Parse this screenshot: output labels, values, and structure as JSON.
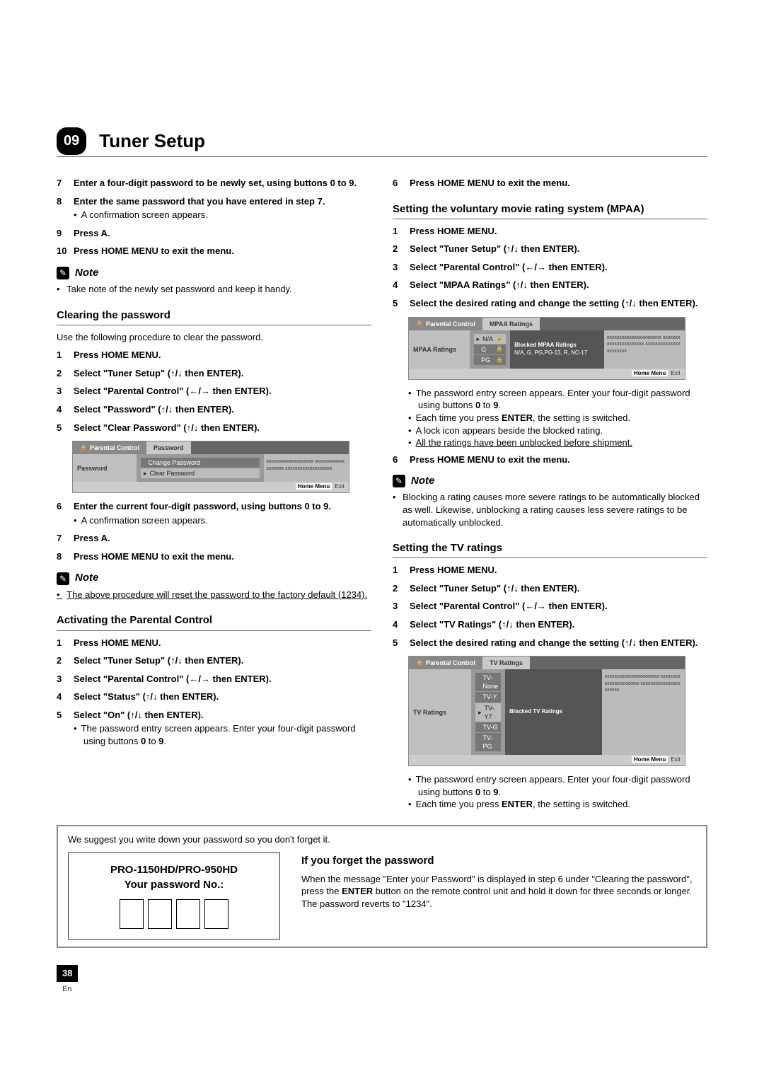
{
  "chapter": {
    "number": "09",
    "title": "Tuner Setup"
  },
  "left": {
    "initialSteps": [
      {
        "n": "7",
        "text": "Enter a four-digit password to be newly set, using buttons 0 to 9."
      },
      {
        "n": "8",
        "text": "Enter the same password that you have entered in step 7.",
        "bullets": [
          "A confirmation screen appears."
        ]
      },
      {
        "n": "9",
        "text": "Press A."
      },
      {
        "n": "10",
        "text": "Press HOME MENU to exit the menu."
      }
    ],
    "note1": "Take note of the newly set password and keep it handy.",
    "clearing": {
      "title": "Clearing the password",
      "intro": "Use the following procedure to clear the password.",
      "steps": [
        {
          "n": "1",
          "text": "Press HOME MENU."
        },
        {
          "n": "2",
          "text": "Select \"Tuner Setup\" (↑/↓ then ENTER)."
        },
        {
          "n": "3",
          "text": "Select \"Parental Control\" (←/→ then ENTER)."
        },
        {
          "n": "4",
          "text": "Select \"Password\" (↑/↓ then ENTER)."
        },
        {
          "n": "5",
          "text": "Select \"Clear Password\" (↑/↓ then ENTER)."
        }
      ],
      "afterFigSteps": [
        {
          "n": "6",
          "text": "Enter the current four-digit password, using buttons 0 to 9.",
          "bullets": [
            "A confirmation screen appears."
          ]
        },
        {
          "n": "7",
          "text": "Press A."
        },
        {
          "n": "8",
          "text": "Press HOME MENU to exit the menu."
        }
      ],
      "note": "The above procedure will reset the password to the factory default (1234)."
    },
    "activating": {
      "title": "Activating the Parental Control",
      "steps": [
        {
          "n": "1",
          "text": "Press HOME MENU."
        },
        {
          "n": "2",
          "text": "Select \"Tuner Setup\" (↑/↓ then ENTER)."
        },
        {
          "n": "3",
          "text": "Select \"Parental Control\" (←/→ then ENTER)."
        },
        {
          "n": "4",
          "text": "Select \"Status\" (↑/↓ then ENTER)."
        },
        {
          "n": "5",
          "text": "Select \"On\" (↑/↓ then ENTER).",
          "bullets": [
            "The password entry screen appears. Enter your four-digit password using buttons 0 to 9."
          ]
        }
      ]
    },
    "osd1": {
      "crumb1": "Parental Control",
      "crumb2": "Password",
      "left": "Password",
      "opts": [
        "Change Password",
        "Clear Password"
      ],
      "sel": 1,
      "right": "xxxxxxxxxxxxxxxxxxx\nxxxxxxxxxxxxxxxxxxx\nxxxxxxxxxxxxxxxxxxx",
      "footer": {
        "k1": "Home Menu",
        "k2": "Exit"
      }
    }
  },
  "right": {
    "preStep": {
      "n": "6",
      "text": "Press HOME MENU to exit the menu."
    },
    "mpaa": {
      "title": "Setting the voluntary movie rating system (MPAA)",
      "steps": [
        {
          "n": "1",
          "text": "Press HOME MENU."
        },
        {
          "n": "2",
          "text": "Select \"Tuner Setup\" (↑/↓ then ENTER)."
        },
        {
          "n": "3",
          "text": "Select \"Parental Control\" (←/→ then ENTER)."
        },
        {
          "n": "4",
          "text": "Select \"MPAA Ratings\" (↑/↓ then ENTER)."
        },
        {
          "n": "5",
          "text": "Select the desired rating and change the setting (↑/↓ then ENTER)."
        }
      ],
      "postBullets": [
        "The password entry screen appears. Enter your four-digit password using buttons 0 to 9.",
        "Each time you press ENTER, the setting is switched.",
        "A lock icon appears beside the blocked rating.",
        "All the ratings have been unblocked before shipment."
      ],
      "after": {
        "n": "6",
        "text": "Press HOME MENU to exit the menu."
      },
      "note": "Blocking a rating causes more severe ratings to be automatically blocked as well. Likewise, unblocking a rating causes less severe ratings to be automatically unblocked."
    },
    "osd2": {
      "crumb1": "Parental Control",
      "crumb2": "MPAA Ratings",
      "left": "MPAA Ratings",
      "opts": [
        "N/A",
        "G",
        "PG"
      ],
      "sel": 0,
      "infoTitle": "Blocked MPAA Ratings",
      "infoText": "N/A, G, PG,PG-13, R, NC-17",
      "right": "xxxxxxxxxxxxxxxxxxxxxx\nxxxxxxxxxxxxxxxxxxxxxx\nxxxxxxxxxxxxxxxxxxxxxx",
      "footer": {
        "k1": "Home Menu",
        "k2": "Exit"
      }
    },
    "tvratings": {
      "title": "Setting the TV ratings",
      "steps": [
        {
          "n": "1",
          "text": "Press HOME MENU."
        },
        {
          "n": "2",
          "text": "Select \"Tuner Setup\" (↑/↓ then ENTER)."
        },
        {
          "n": "3",
          "text": "Select \"Parental Control\" (←/→ then ENTER)."
        },
        {
          "n": "4",
          "text": "Select \"TV Ratings\" (↑/↓ then ENTER)."
        },
        {
          "n": "5",
          "text": "Select the desired rating and change the setting (↑/↓ then ENTER)."
        }
      ],
      "postBullets": [
        "The password entry screen appears. Enter your four-digit password using buttons 0 to 9.",
        "Each time you press ENTER, the setting is switched."
      ]
    },
    "osd3": {
      "crumb1": "Parental Control",
      "crumb2": "TV Ratings",
      "left": "TV Ratings",
      "opts": [
        "TV-None",
        "TV-Y",
        "TV-Y7",
        "TV-G",
        "TV-PG"
      ],
      "sel": 2,
      "infoTitle": "Blocked TV Ratings",
      "right": "xxxxxxxxxxxxxxxxxxxxxx\nxxxxxxxxxxxxxxxxxxxxxx\nxxxxxxxxxxxxxxxxxxxxxx",
      "footer": {
        "k1": "Home Menu",
        "k2": "Exit"
      }
    }
  },
  "passwordBox": {
    "suggest": "We suggest you write down your password so you don't forget it.",
    "model": "PRO-1150HD/PRO-950HD",
    "label": "Your password No.:",
    "forgetTitle": "If you forget the password",
    "forgetBody": "When the message \"Enter your Password\" is displayed in step 6 under \"Clearing the password\", press the ENTER button on the remote control unit and hold it down for three seconds or longer. The password reverts to \"1234\"."
  },
  "pageNum": "38",
  "lang": "En",
  "noteLabel": "Note"
}
